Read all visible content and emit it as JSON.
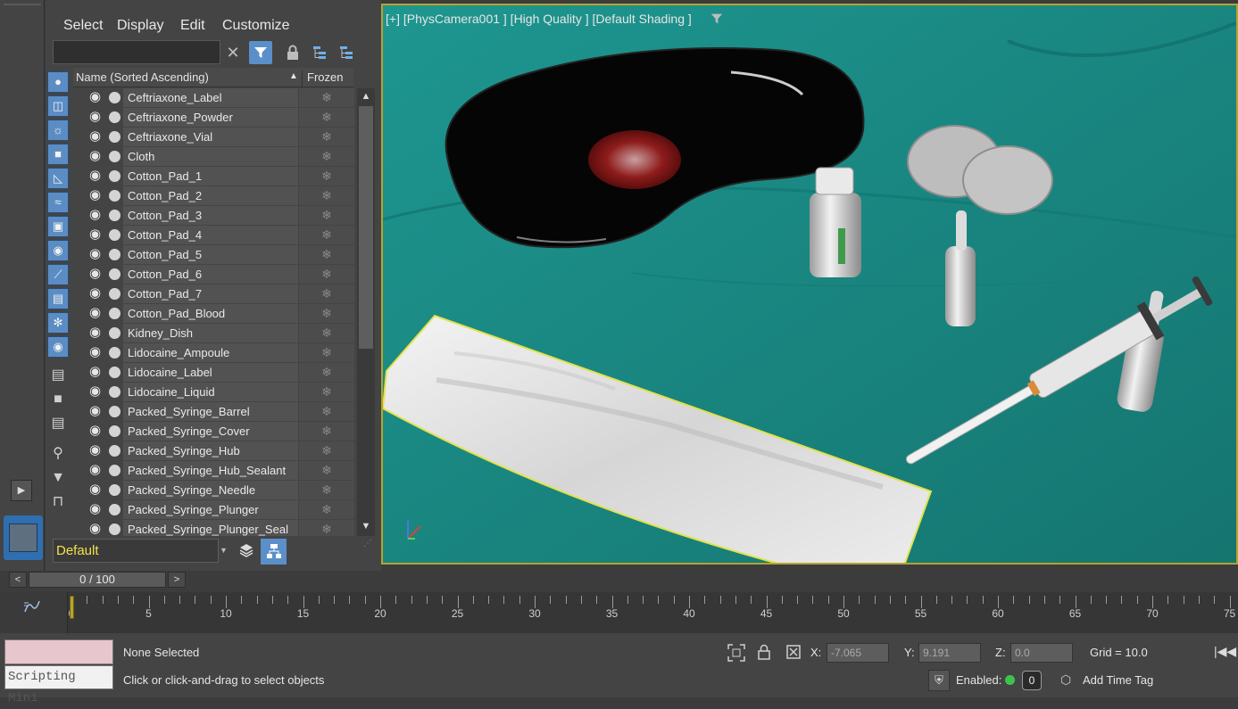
{
  "explorer": {
    "menu": [
      "Select",
      "Display",
      "Edit",
      "Customize"
    ],
    "search_placeholder": "",
    "column_name": "Name (Sorted Ascending)",
    "column_frozen": "Frozen",
    "sort_indicator": "▲",
    "objects": [
      "Ceftriaxone_Label",
      "Ceftriaxone_Powder",
      "Ceftriaxone_Vial",
      "Cloth",
      "Cotton_Pad_1",
      "Cotton_Pad_2",
      "Cotton_Pad_3",
      "Cotton_Pad_4",
      "Cotton_Pad_5",
      "Cotton_Pad_6",
      "Cotton_Pad_7",
      "Cotton_Pad_Blood",
      "Kidney_Dish",
      "Lidocaine_Ampoule",
      "Lidocaine_Label",
      "Lidocaine_Liquid",
      "Packed_Syringe_Barrel",
      "Packed_Syringe_Cover",
      "Packed_Syringe_Hub",
      "Packed_Syringe_Hub_Sealant",
      "Packed_Syringe_Needle",
      "Packed_Syringe_Plunger",
      "Packed_Syringe_Plunger_Seal"
    ],
    "layer": "Default",
    "icons": {
      "clear": "close-icon",
      "filter": "filter-icon",
      "lock": "lock-icon",
      "hierarchy": "hierarchy-icon",
      "visibility": "eye-icon",
      "render": "render-dot-icon",
      "frozen": "snowflake-icon"
    }
  },
  "viewport": {
    "label": "[+] [PhysCamera001 ] [High Quality ] [Default Shading ]",
    "background_color": "#1c8a85",
    "border_color": "#b7a32e"
  },
  "timeline": {
    "frame_display": "0 / 100",
    "prev": "<",
    "next": ">",
    "ticks": [
      "0",
      "5",
      "10",
      "15",
      "20",
      "25",
      "30",
      "35",
      "40",
      "45",
      "50",
      "55",
      "60",
      "65",
      "70",
      "75"
    ]
  },
  "status": {
    "mini_listener": "Scripting Mini",
    "selection": "None Selected",
    "prompt": "Click or click-and-drag to select objects",
    "x_label": "X:",
    "x_value": "-7.065",
    "y_label": "Y:",
    "y_value": "9.191",
    "z_label": "Z:",
    "z_value": "0.0",
    "grid": "Grid = 10.0",
    "enabled_label": "Enabled:",
    "time_tag_count": "0",
    "add_time_tag": "Add Time Tag"
  }
}
